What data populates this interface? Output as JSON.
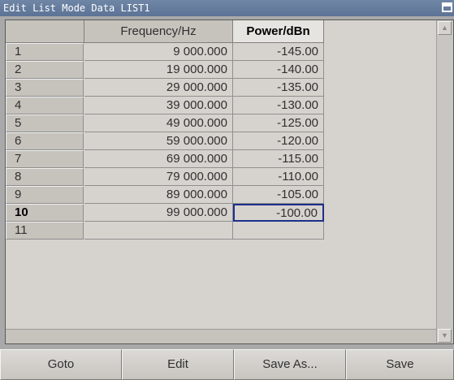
{
  "window": {
    "title": "Edit List Mode Data LIST1"
  },
  "table": {
    "headers": {
      "frequency": "Frequency/Hz",
      "power": "Power/dBn"
    },
    "rows": [
      {
        "index": "1",
        "frequency": "9 000.000",
        "power": "-145.00"
      },
      {
        "index": "2",
        "frequency": "19 000.000",
        "power": "-140.00"
      },
      {
        "index": "3",
        "frequency": "29 000.000",
        "power": "-135.00"
      },
      {
        "index": "4",
        "frequency": "39 000.000",
        "power": "-130.00"
      },
      {
        "index": "5",
        "frequency": "49 000.000",
        "power": "-125.00"
      },
      {
        "index": "6",
        "frequency": "59 000.000",
        "power": "-120.00"
      },
      {
        "index": "7",
        "frequency": "69 000.000",
        "power": "-115.00"
      },
      {
        "index": "8",
        "frequency": "79 000.000",
        "power": "-110.00"
      },
      {
        "index": "9",
        "frequency": "89 000.000",
        "power": "-105.00"
      },
      {
        "index": "10",
        "frequency": "99 000.000",
        "power": "-100.00"
      },
      {
        "index": "11",
        "frequency": "",
        "power": ""
      }
    ],
    "selected_row": "10"
  },
  "buttons": {
    "goto": "Goto",
    "edit": "Edit",
    "save_as": "Save As...",
    "save": "Save"
  },
  "colors": {
    "title_bar": "#5c7396",
    "selection_border": "#1c2f8a",
    "panel": "#d6d3ce"
  }
}
